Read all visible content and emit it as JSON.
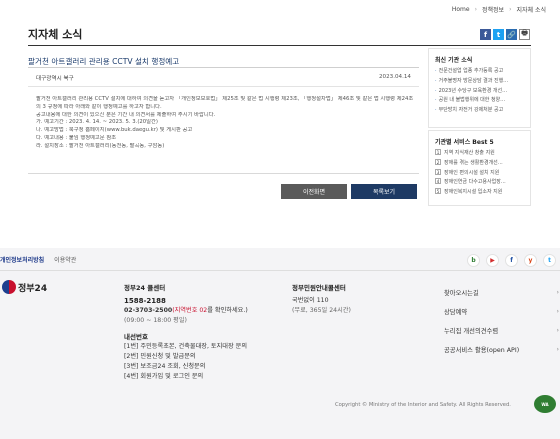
{
  "breadcrumb": {
    "home": "Home",
    "section": "정책정보",
    "current": "지자체 소식"
  },
  "page": {
    "title": "지자체 소식"
  },
  "share": {
    "facebook": "f",
    "twitter": "t",
    "link": "🔗",
    "print": "🖶"
  },
  "article": {
    "title": "팔거천 아트갤러리 관리용 CCTV 설치 행정예고",
    "org": "대구광역시 북구",
    "date": "2023.04.14",
    "lines": [
      "팔거천 아트갤러리 관리용 CCTV 설치에 대하여 의견을 듣고자 「개인정보보호법」 제25조 및 같은 법 시행령 제23조, 「행정절차법」 제46조 및 같은 법 시행령 제24조",
      "의 3 규정에 따라 아래와 같이 행정예고를 하고자 합니다.",
      "공고내용에 대한 의견이 있으신 분은 기간 내 의견서를 제출하여 주시기 바랍니다.",
      "가. 예고기간 : 2023. 4. 14. ~ 2023. 5. 3.(20일간)",
      "나. 예고방법 : 북구청 홈페이지(www.buk.daegu.kr) 및 게시판 공고",
      "다. 예고내용 : 붙임 행정예고문 참조",
      "라. 설치장소 : 팔거천 아트갤러리(동천동, 팔곡동, 구암동)"
    ]
  },
  "buttons": {
    "prev": "이전화면",
    "list": "목록보기"
  },
  "sidebar": {
    "latest_title": "최신 기관 소식",
    "latest_items": [
      "전문건설업 업종 추가등록 공고",
      "거주불명자 방문상담 결과 진행…",
      "2023년 수당구 보육환경 개선…",
      "공원 내 불법행위에 대한 청양…",
      "무단방치 자전거 강제처분 공고"
    ],
    "best_title": "기관별 서비스 Best 5",
    "best_items": [
      {
        "n": "1",
        "label": "지역 지식재산 창출 지원"
      },
      {
        "n": "2",
        "label": "장애를 겪는 생활환경개선…"
      },
      {
        "n": "3",
        "label": "장애인 편의시설 설치 지원"
      },
      {
        "n": "4",
        "label": "장애인연금 다수고용사업장…"
      },
      {
        "n": "5",
        "label": "장애인복지시설 입소자 지원"
      }
    ]
  },
  "footer": {
    "privacy": "개인정보처리방침",
    "terms": "이용약관",
    "social": [
      "b",
      "▶",
      "f",
      "y",
      "t"
    ],
    "social_colors": [
      "#2e7d32",
      "#d32f2f",
      "#1e4fa3",
      "#d84315",
      "#1da1f2"
    ],
    "brand": "정부24",
    "callcenter": {
      "title": "정부24 콜센터",
      "phone": "1588-2188",
      "alt_prefix": "02-3703-2500",
      "alt_red": "(지역번호 02",
      "alt_suffix": "를 확인하세요.)",
      "hours": "(09:00 ~ 18:00 평일)",
      "ext_title": "내선번호",
      "ext": [
        "[1번] 주민등록초본, 건축물대장, 토지대장 문의",
        "[2번] 민원신청 및 발급문의",
        "[3번] 보조금24 조회, 신청문의",
        "[4번] 회원가입 및 로그인 문의"
      ]
    },
    "helpdesk": {
      "title": "정부민원안내콜센터",
      "phone_label": "국번없이 110",
      "hours": "(무료, 365일 24시간)"
    },
    "quick": [
      "찾아오시는길",
      "상담예약",
      "누리집 개선의견수렴",
      "공공서비스 활용(open API)"
    ],
    "copyright": "Copyright © Ministry of the Interior and Safety. All Rights Reserved."
  }
}
